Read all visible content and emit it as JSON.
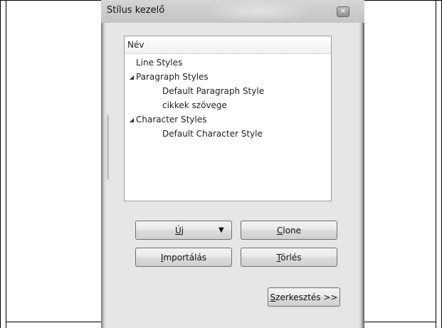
{
  "window": {
    "title": "Stílus kezelő",
    "close_symbol": "✕"
  },
  "tree": {
    "header": "Név",
    "items": [
      {
        "label": "Line Styles",
        "expander": ""
      },
      {
        "label": "Paragraph Styles",
        "expander": "◢"
      },
      {
        "label": "Default Paragraph Style",
        "expander": ""
      },
      {
        "label": "cikkek szövege",
        "expander": ""
      },
      {
        "label": "Character Styles",
        "expander": "◢"
      },
      {
        "label": "Default Character Style",
        "expander": ""
      }
    ]
  },
  "buttons": {
    "new": {
      "mnemonic": "Ú",
      "rest": "j",
      "arrow": "▼"
    },
    "clone": {
      "mnemonic": "C",
      "rest": "lone"
    },
    "import": {
      "mnemonic": "I",
      "rest": "mportálás"
    },
    "delete": {
      "mnemonic": "T",
      "rest": "örlés"
    },
    "edit": {
      "mnemonic": "S",
      "rest": "zerkesztés >>"
    }
  }
}
